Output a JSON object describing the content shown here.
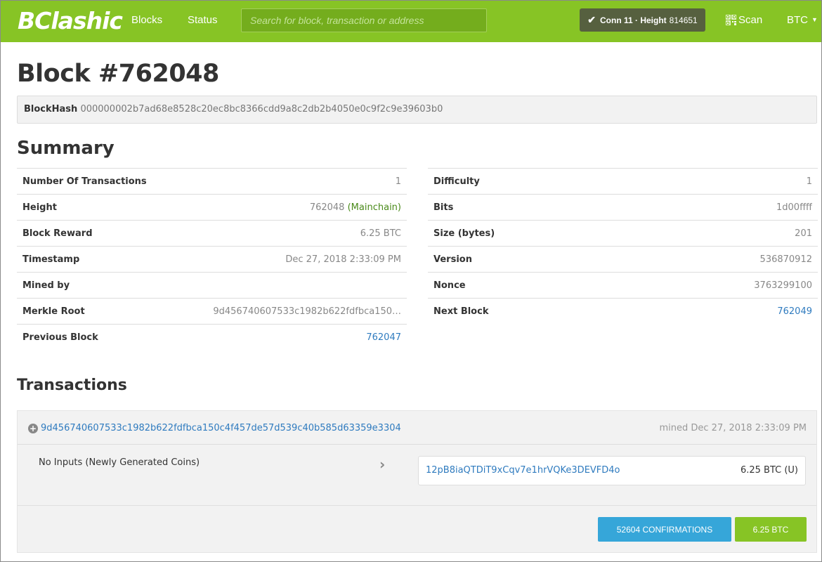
{
  "navbar": {
    "logo": "BClashic",
    "links": {
      "blocks": "Blocks",
      "status": "Status"
    },
    "search_placeholder": "Search for block, transaction or address",
    "conn_label": "Conn 11 · Height",
    "conn_height": "814651",
    "scan_label": "Scan",
    "currency": "BTC",
    "colors": {
      "brand": "#87c425",
      "badge": "#56603f"
    }
  },
  "block": {
    "title": "Block #762048",
    "hash_label": "BlockHash",
    "hash_value": "000000002b7ad68e8528c20ec8bc8366cdd9a8c2db2b4050e0c9f2c9e39603b0"
  },
  "summary": {
    "title": "Summary",
    "left": [
      {
        "key": "Number Of Transactions",
        "value": "1"
      },
      {
        "key": "Height",
        "value": "762048",
        "extra": "(Mainchain)"
      },
      {
        "key": "Block Reward",
        "value": "6.25 BTC"
      },
      {
        "key": "Timestamp",
        "value": "Dec 27, 2018 2:33:09 PM"
      },
      {
        "key": "Mined by",
        "value": ""
      },
      {
        "key": "Merkle Root",
        "value": "9d456740607533c1982b622fdfbca150…"
      },
      {
        "key": "Previous Block",
        "value": "762047"
      }
    ],
    "right": [
      {
        "key": "Difficulty",
        "value": "1"
      },
      {
        "key": "Bits",
        "value": "1d00ffff"
      },
      {
        "key": "Size (bytes)",
        "value": "201"
      },
      {
        "key": "Version",
        "value": "536870912"
      },
      {
        "key": "Nonce",
        "value": "3763299100"
      },
      {
        "key": "Next Block",
        "value": "762049"
      }
    ]
  },
  "transactions": {
    "title": "Transactions",
    "items": [
      {
        "txid": "9d456740607533c1982b622fdfbca150c4f457de57d539c40b585d63359e3304",
        "mined": "mined Dec 27, 2018 2:33:09 PM",
        "input": "No Inputs (Newly Generated Coins)",
        "output_address": "12pB8iaQTDiT9xCqv7e1hrVQKe3DEVFD4o",
        "output_amount": "6.25 BTC (U)",
        "confirmations": "52604 CONFIRMATIONS",
        "total": "6.25 BTC"
      }
    ]
  }
}
